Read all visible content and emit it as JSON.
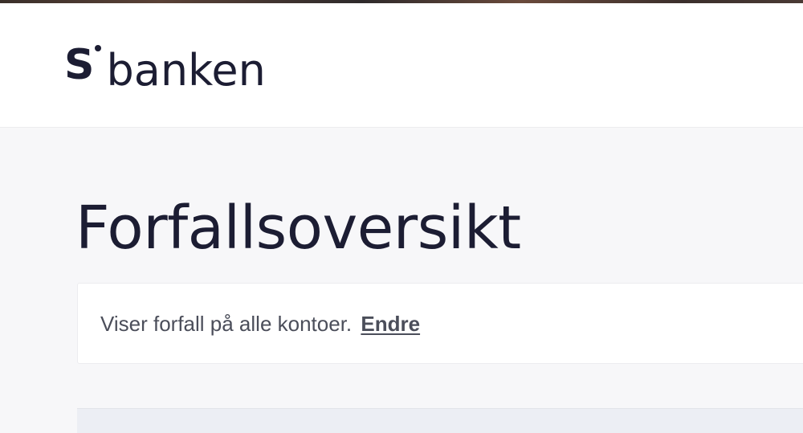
{
  "header": {
    "logo": {
      "letter": "S",
      "wordmark": "banken"
    }
  },
  "main": {
    "title": "Forfallsoversikt",
    "filter_info": {
      "text": "Viser forfall på alle kontoer.",
      "link_label": "Endre"
    }
  },
  "colors": {
    "brand_text": "#1c1d33",
    "page_background": "#f7f7f9",
    "card_background": "#ffffff",
    "body_text": "#4b4e5a"
  }
}
